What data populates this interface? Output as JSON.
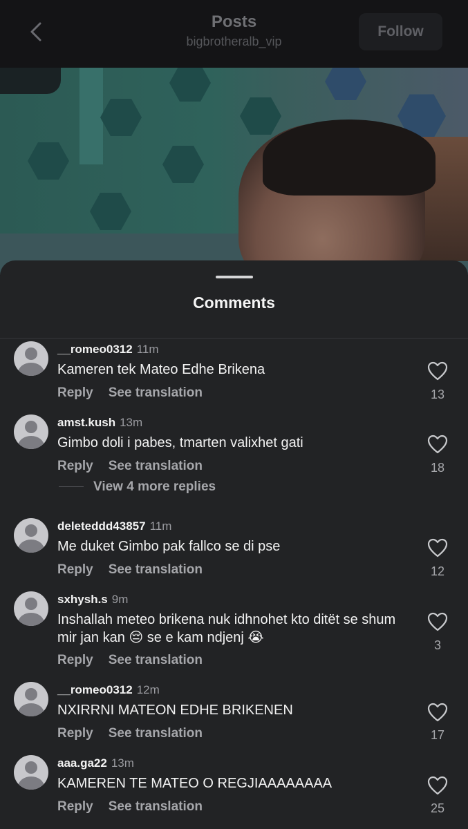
{
  "header": {
    "title": "Posts",
    "username": "bigbrotheralb_vip",
    "follow_label": "Follow"
  },
  "sheet": {
    "title": "Comments"
  },
  "actions": {
    "reply": "Reply",
    "translate": "See translation"
  },
  "comments": [
    {
      "user": "__romeo0312",
      "time": "11m",
      "text": "Kameren tek Mateo Edhe Brikena",
      "likes": "13"
    },
    {
      "user": "amst.kush",
      "time": "13m",
      "text": "Gimbo doli i pabes, tmarten valixhet gati",
      "likes": "18",
      "more_replies": "View 4 more replies"
    },
    {
      "user": "deleteddd43857",
      "time": "11m",
      "text": "Me duket Gimbo pak fallco se di pse",
      "likes": "12"
    },
    {
      "user": "sxhysh.s",
      "time": "9m",
      "text": "Inshallah meteo brikena nuk idhnohet kto ditët se shum mir jan kan 😔 se e kam ndjenj 😭",
      "likes": "3"
    },
    {
      "user": "__romeo0312",
      "time": "12m",
      "text": "NXIRRNI MATEON EDHE BRIKENEN",
      "likes": "17"
    },
    {
      "user": "aaa.ga22",
      "time": "13m",
      "text": "KAMEREN TE MATEO O REGJIAAAAAAAA",
      "likes": "25"
    }
  ]
}
